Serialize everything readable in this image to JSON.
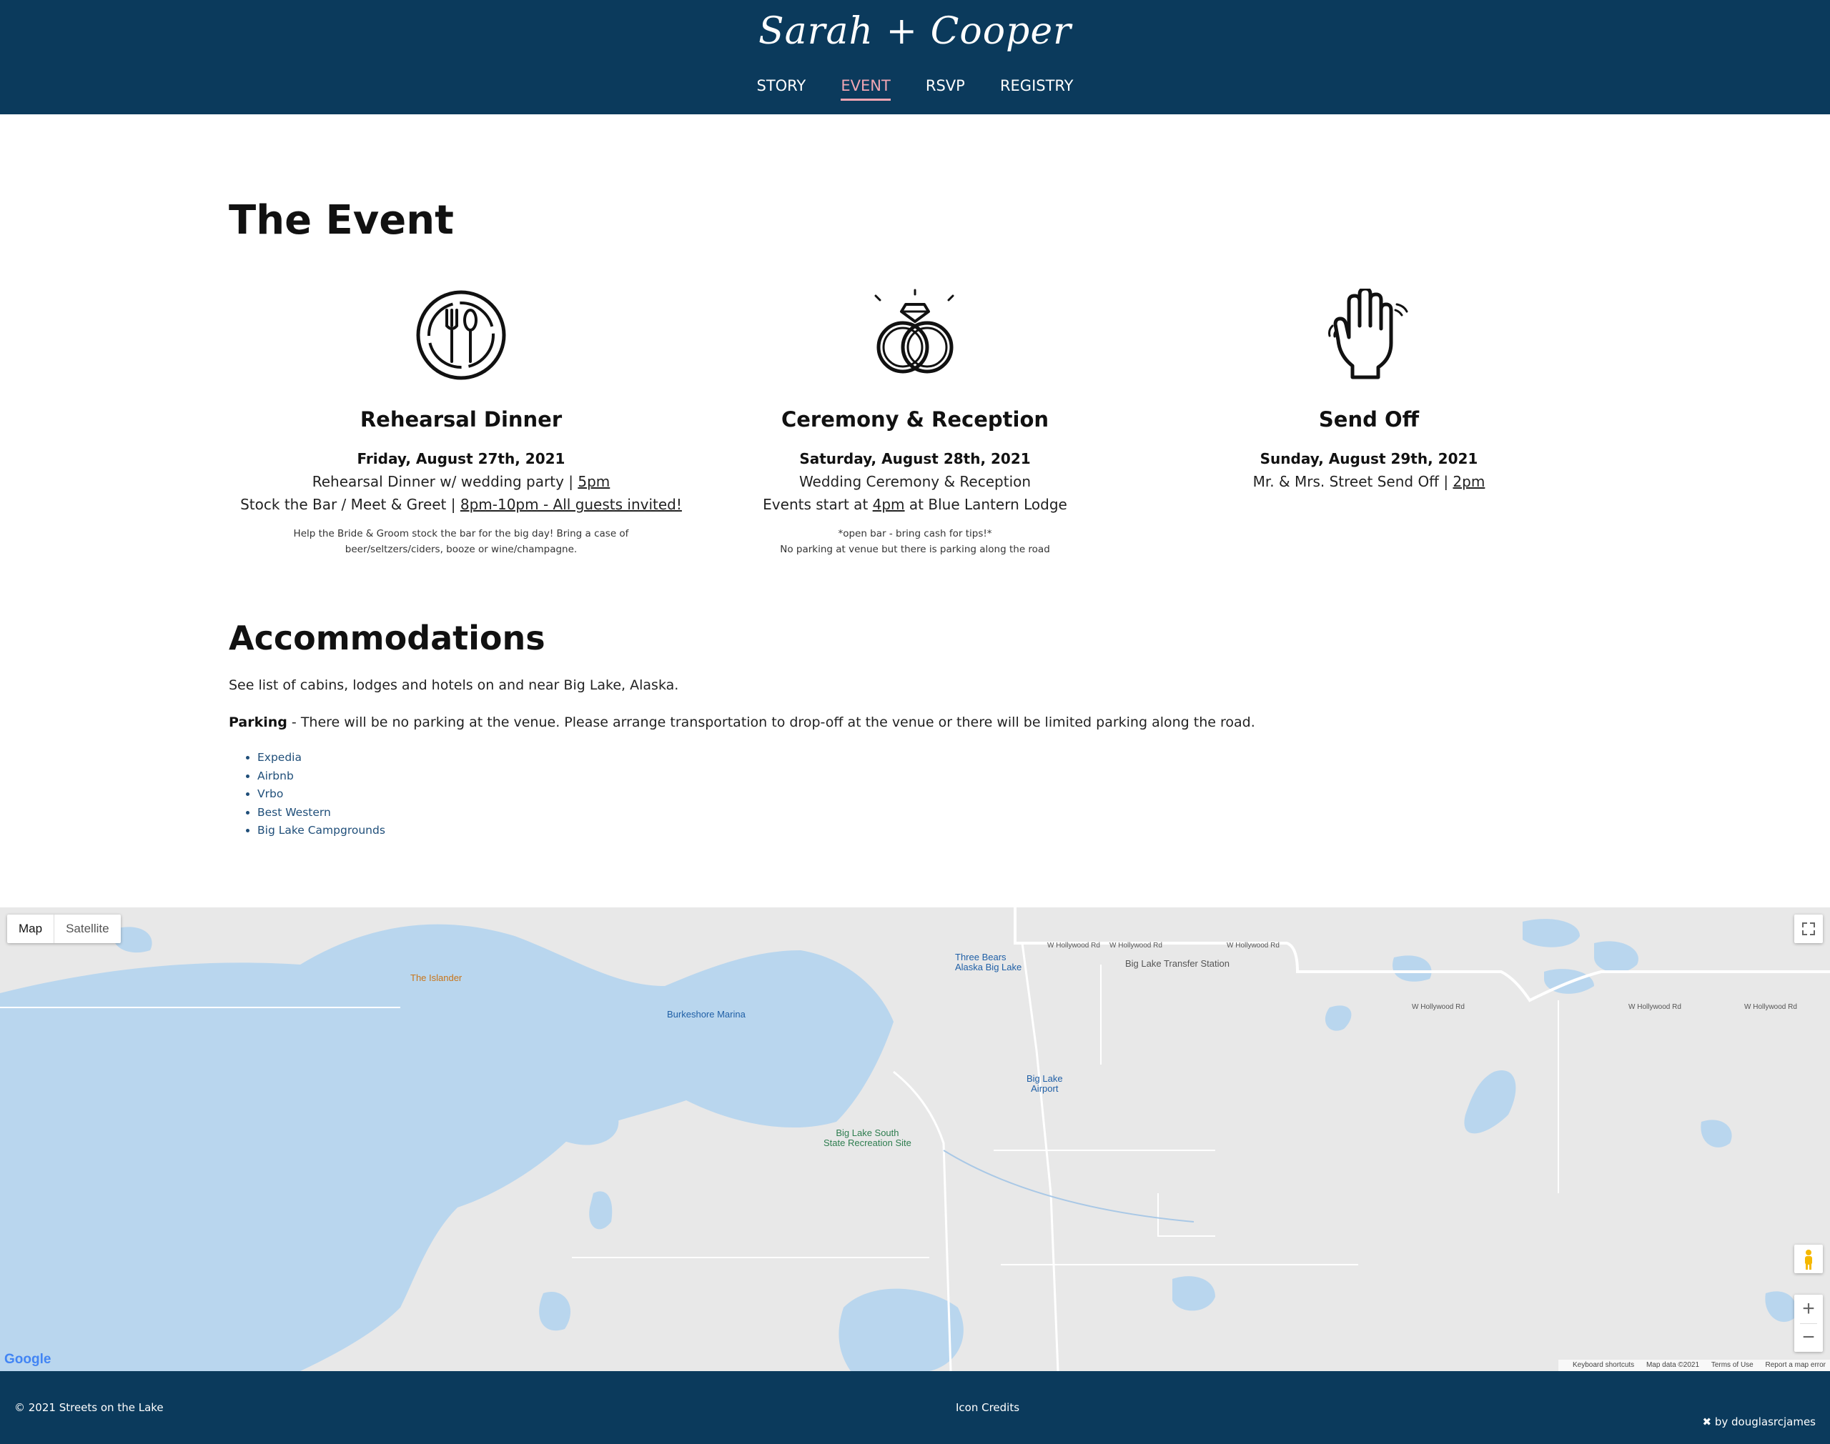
{
  "header": {
    "brand": "Sarah + Cooper",
    "nav": [
      {
        "label": "STORY",
        "active": false
      },
      {
        "label": "EVENT",
        "active": true
      },
      {
        "label": "RSVP",
        "active": false
      },
      {
        "label": "REGISTRY",
        "active": false
      }
    ],
    "background_color": "#0b3a5c",
    "active_color": "#f2a6b3"
  },
  "main": {
    "title": "The Event",
    "events": [
      {
        "icon": "plate-fork-spoon-icon",
        "name": "Rehearsal Dinner",
        "date": "Friday, August 27th, 2021",
        "line1_pre": "Rehearsal Dinner w/ wedding party | ",
        "line1_u": "5pm",
        "line1_post": "",
        "line2_pre": "Stock the Bar / Meet & Greet | ",
        "line2_u": "8pm-10pm - All guests invited!",
        "note1": "Help the Bride & Groom stock the bar for the big day! Bring a case of beer/seltzers/ciders, booze or wine/champagne.",
        "note2": ""
      },
      {
        "icon": "wedding-rings-icon",
        "name": "Ceremony & Reception",
        "date": "Saturday, August 28th, 2021",
        "line1_pre": "Wedding Ceremony & Reception",
        "line1_u": "",
        "line1_post": "",
        "line2_pre": "Events start at ",
        "line2_u": "4pm",
        "line2_post": " at Blue Lantern Lodge",
        "note1": "*open bar - bring cash for tips!*",
        "note2": "No parking at venue but there is parking along the road"
      },
      {
        "icon": "waving-hand-icon",
        "name": "Send Off",
        "date": "Sunday, August 29th, 2021",
        "line1_pre": "Mr. & Mrs. Street Send Off | ",
        "line1_u": "2pm",
        "line1_post": ""
      }
    ],
    "accommodations": {
      "title": "Accommodations",
      "intro": "See list of cabins, lodges and hotels on and near Big Lake, Alaska.",
      "parking_label": "Parking",
      "parking_text": " - There will be no parking at the venue. Please arrange transportation to drop-off at the venue or there will be limited parking along the road.",
      "links": [
        "Expedia",
        "Airbnb",
        "Vrbo",
        "Best Western",
        "Big Lake Campgrounds"
      ]
    }
  },
  "map": {
    "type_buttons": [
      "Map",
      "Satellite"
    ],
    "selected_type": "Map",
    "pois": {
      "islander": "The Islander",
      "marina": "Burkeshore Marina",
      "three_bears_1": "Three Bears",
      "three_bears_2": "Alaska Big Lake",
      "transfer": "Big Lake Transfer Station",
      "airport_1": "Big Lake",
      "airport_2": "Airport",
      "rec_1": "Big Lake South",
      "rec_2": "State Recreation Site"
    },
    "road_label": "W Hollywood Rd",
    "logo": "Google",
    "attribution": [
      "Keyboard shortcuts",
      "Map data ©2021",
      "Terms of Use",
      "Report a map error"
    ],
    "water_color": "#b9d6ee",
    "land_color": "#e8e8e8"
  },
  "footer": {
    "copyright": "© 2021 Streets on the Lake",
    "credits": "Icon Credits",
    "by": "by douglasrcjames"
  }
}
